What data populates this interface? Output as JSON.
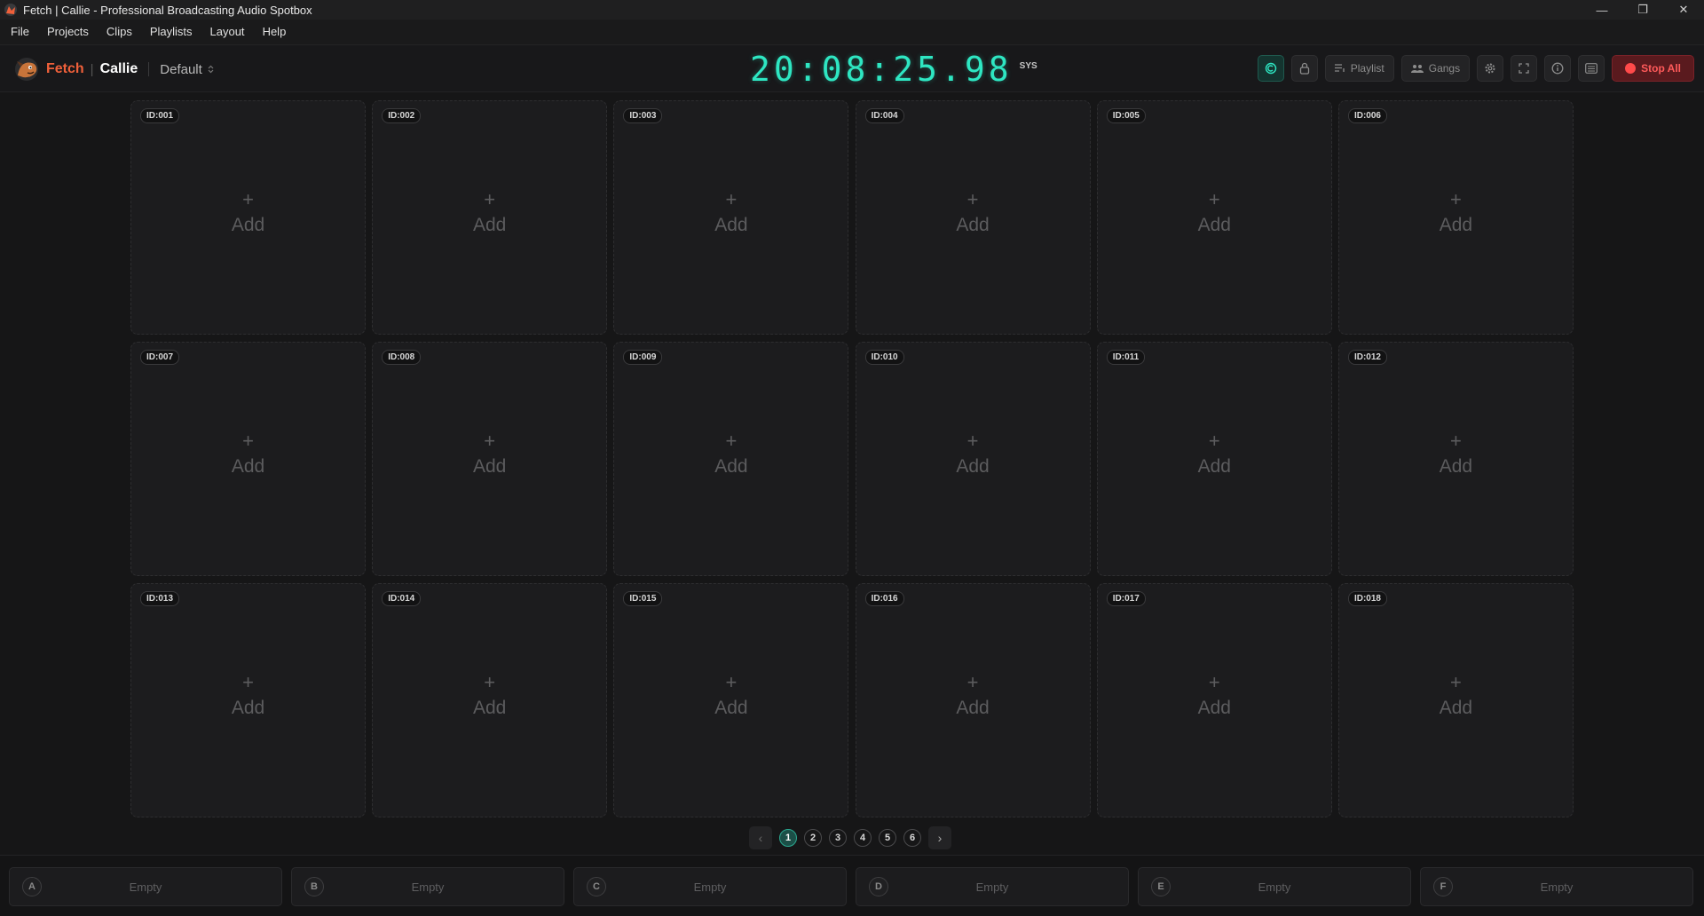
{
  "window": {
    "title": "Fetch | Callie - Professional Broadcasting Audio Spotbox",
    "minimize": "—",
    "restore": "❐",
    "close": "✕"
  },
  "menu": [
    "File",
    "Projects",
    "Clips",
    "Playlists",
    "Layout",
    "Help"
  ],
  "brand": {
    "fetch": "Fetch",
    "sep": "|",
    "callie": "Callie",
    "accent": "#f0603a"
  },
  "project": {
    "name": "Default"
  },
  "clock": {
    "time": "20:08:25.98",
    "label": "SYS",
    "color": "#2ee6c2"
  },
  "toolbar": {
    "playlist_label": "Playlist",
    "gangs_label": "Gangs",
    "stop_all_label": "Stop All",
    "stop_color": "#ff4a4a"
  },
  "grid": {
    "add_label": "Add",
    "plus": "+",
    "slots": [
      {
        "id": "ID:001"
      },
      {
        "id": "ID:002"
      },
      {
        "id": "ID:003"
      },
      {
        "id": "ID:004"
      },
      {
        "id": "ID:005"
      },
      {
        "id": "ID:006"
      },
      {
        "id": "ID:007"
      },
      {
        "id": "ID:008"
      },
      {
        "id": "ID:009"
      },
      {
        "id": "ID:010"
      },
      {
        "id": "ID:011"
      },
      {
        "id": "ID:012"
      },
      {
        "id": "ID:013"
      },
      {
        "id": "ID:014"
      },
      {
        "id": "ID:015"
      },
      {
        "id": "ID:016"
      },
      {
        "id": "ID:017"
      },
      {
        "id": "ID:018"
      }
    ]
  },
  "pager": {
    "prev": "‹",
    "next": "›",
    "pages": [
      "1",
      "2",
      "3",
      "4",
      "5",
      "6"
    ],
    "current": "1"
  },
  "lanes": [
    {
      "letter": "A",
      "status": "Empty"
    },
    {
      "letter": "B",
      "status": "Empty"
    },
    {
      "letter": "C",
      "status": "Empty"
    },
    {
      "letter": "D",
      "status": "Empty"
    },
    {
      "letter": "E",
      "status": "Empty"
    },
    {
      "letter": "F",
      "status": "Empty"
    }
  ]
}
